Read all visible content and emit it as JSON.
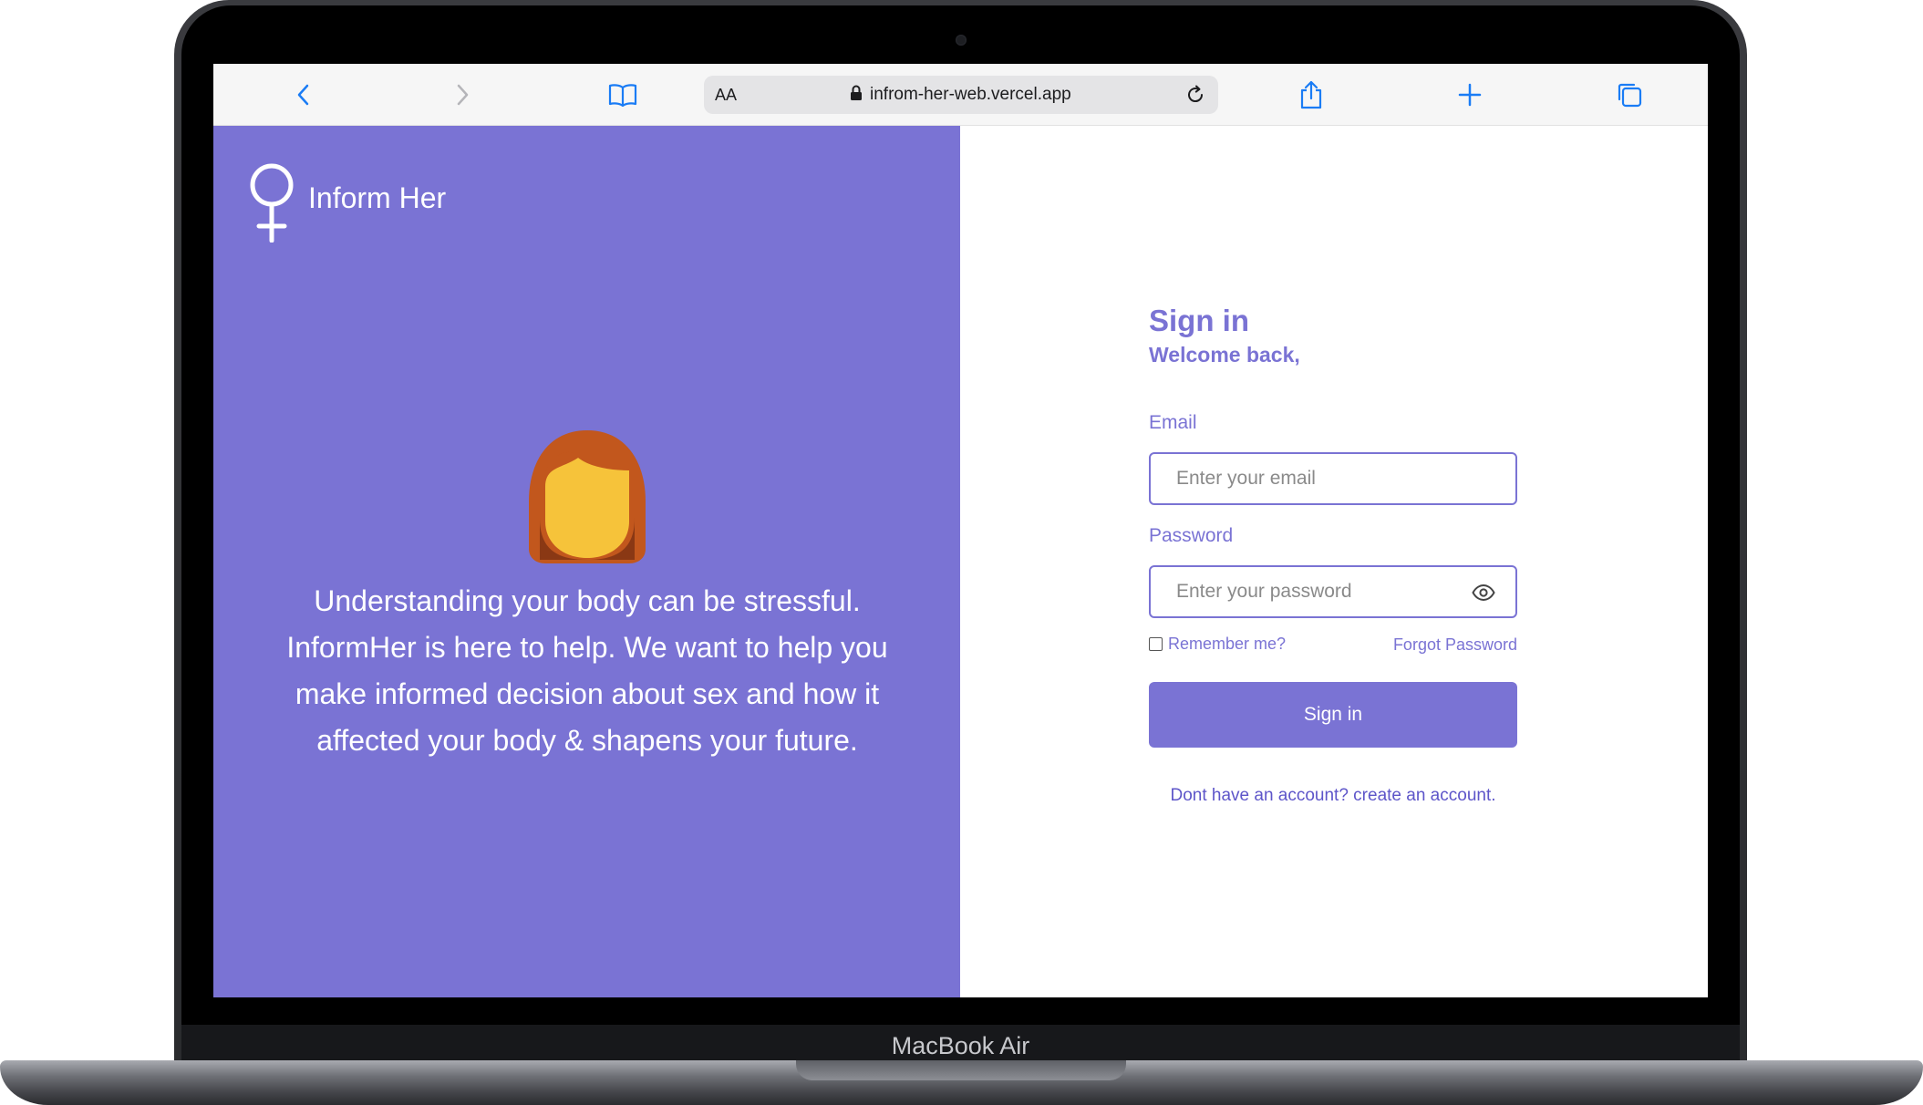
{
  "device": {
    "brand_label": "MacBook Air"
  },
  "browser": {
    "text_size_label": "AA",
    "url": "infrom-her-web.vercel.app",
    "icons": {
      "back": "chevron-left-icon",
      "forward": "chevron-right-icon",
      "bookmarks": "book-icon",
      "lock": "lock-icon",
      "reload": "reload-icon",
      "share": "share-icon",
      "new_tab": "plus-icon",
      "tabs": "tabs-icon"
    },
    "accent_color": "#1a7cf5"
  },
  "hero": {
    "logo_text": "Inform Her",
    "logo_icon": "venus-icon",
    "avatar_icon": "woman-avatar-icon",
    "message": "Understanding your body can be stressful. InformHer is here to help. We want to help you make informed decision about sex and how it affected your body & shapens your future.",
    "background_color": "#7a73d4"
  },
  "signin": {
    "title": "Sign in",
    "subtitle": "Welcome back,",
    "email_label": "Email",
    "email_placeholder": "Enter your email",
    "email_value": "",
    "password_label": "Password",
    "password_placeholder": "Enter your password",
    "password_value": "",
    "remember_label": "Remember me?",
    "remember_checked": false,
    "forgot_label": "Forgot Password",
    "button_label": "Sign in",
    "register_text": "Dont have an account? create an account.",
    "accent_color": "#7a73d4"
  }
}
